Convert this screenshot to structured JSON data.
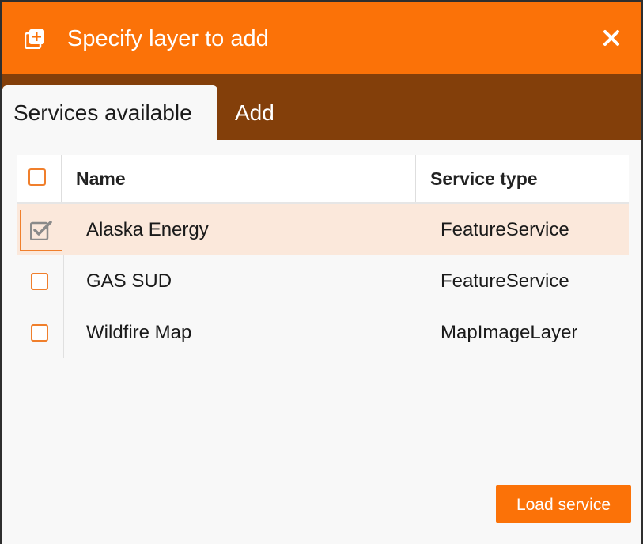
{
  "dialog": {
    "title": "Specify layer to add",
    "title_icon": "add-layer-icon",
    "close_icon": "close-icon"
  },
  "tabs": [
    {
      "label": "Services available",
      "active": true
    },
    {
      "label": "Add",
      "active": false
    }
  ],
  "table": {
    "columns": [
      "Name",
      "Service type"
    ],
    "rows": [
      {
        "name": "Alaska Energy",
        "type": "FeatureService",
        "checked": true
      },
      {
        "name": "GAS SUD",
        "type": "FeatureService",
        "checked": false
      },
      {
        "name": "Wildfire Map",
        "type": "MapImageLayer",
        "checked": false
      }
    ]
  },
  "footer": {
    "load_label": "Load service"
  },
  "colors": {
    "accent": "#fb7208",
    "tab_bar": "#833f0a",
    "selected_row": "#fbe8db"
  }
}
